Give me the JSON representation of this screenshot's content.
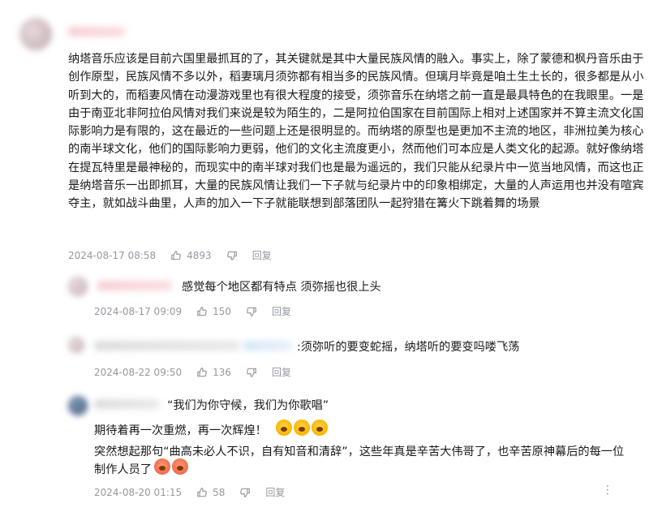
{
  "main_comment": {
    "text": "纳塔音乐应该是目前六国里最抓耳的了，其关键就是其中大量民族风情的融入。事实上，除了蒙德和枫丹音乐由于创作原型，民族风情不多以外，稻妻璃月须弥都有相当多的民族风情。但璃月毕竟是咱土生土长的，很多都是从小听到大的，而稻妻风情在动漫游戏里也有很大程度的接受，须弥音乐在纳塔之前一直是最具特色的在我眼里。一是由于南亚北非阿拉伯风情对我们来说是较为陌生的，二是阿拉伯国家在目前国际上相对上述国家并不算主流文化国际影响力是有限的，这在最近的一些问题上还是很明显的。而纳塔的原型也是更加不主流的地区，非洲拉美为核心的南半球文化，他们的国际影响力更弱，他们的文化主流度更小，然而他们可本应是人类文化的起源。就好像纳塔在提瓦特里是最神秘的，而现实中的南半球对我们也是最为遥远的，我们只能从纪录片中一览当地风情，而这也正是纳塔音乐一出即抓耳，大量的民族风情让我们一下子就与纪录片中的印象相绑定，大量的人声运用也并没有喧宾夺主，就如战斗曲里，人声的加入一下子就能联想到部落团队一起狩猎在篝火下跳着舞的场景",
    "time": "2024-08-17 08:58",
    "likes": "4893",
    "reply_label": "回复"
  },
  "replies": [
    {
      "text": "感觉每个地区都有特点 须弥摇也很上头",
      "time": "2024-08-17 09:09",
      "likes": "150",
      "reply_label": "回复"
    },
    {
      "text": ":须弥听的要变蛇摇，纳塔听的要变吗喽飞荡",
      "time": "2024-08-22 09:50",
      "likes": "136",
      "reply_label": "回复"
    },
    {
      "text": "“我们为你守候，我们为你歌唱”",
      "line2": "期待着再一次重燃，再一次辉煌！",
      "line3": "突然想起那句“曲高未必人不识，自有知音和清辞”，这些年真是辛苦大伟哥了，也辛苦原神幕后的每一位",
      "line4": "制作人员了",
      "time": "2024-08-20 01:15",
      "likes": "58",
      "reply_label": "回复"
    }
  ],
  "icons": {
    "like": "thumbs-up-icon",
    "dislike": "thumbs-down-icon",
    "more": "more-icon",
    "emoji": "emoji-sticker-icon"
  },
  "more_glyph": "⋮"
}
